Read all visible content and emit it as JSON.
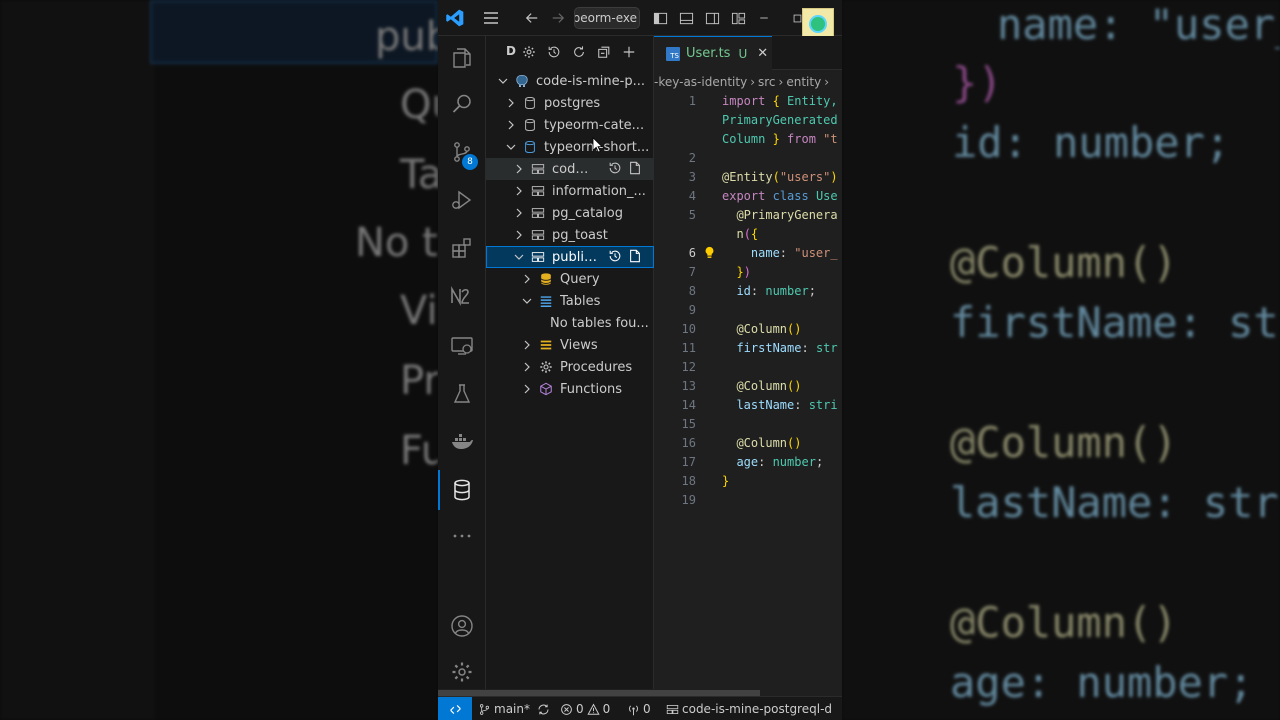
{
  "window": {
    "command_center_text": "ypeorm-exe"
  },
  "background_left": {
    "labels": [
      "pub",
      "Qu",
      "Ta",
      "No t",
      "Vi",
      "Pr",
      "Fu"
    ]
  },
  "background_right": {
    "lines": [
      "name:  \"user_",
      "})",
      "id:  number;",
      "@Column()",
      "firstName:  str",
      "@Column()",
      "lastName:  stri",
      "@Column()",
      "age:  number;"
    ]
  },
  "activity_bar": {
    "scm_badge": "8",
    "items": [
      "explorer-icon",
      "search-icon",
      "source-control-icon",
      "run-debug-icon",
      "extensions-icon",
      "n8n-icon",
      "remote-explorer-icon",
      "testing-icon",
      "docker-icon",
      "database-icon",
      "more-icon",
      "accounts-icon",
      "manage-icon"
    ]
  },
  "sidebar": {
    "title_fragment": "D",
    "tree": {
      "connection": "code-is-mine-p...",
      "databases": [
        "postgres",
        "typeorm-cate...",
        "typeorm-short..."
      ],
      "schemas": [
        "codei...",
        "information_...",
        "pg_catalog",
        "pg_toast",
        "public..."
      ],
      "public_children": {
        "query": "Query",
        "tables": "Tables",
        "no_tables": "No tables fou...",
        "views": "Views",
        "procedures": "Procedures",
        "functions": "Functions"
      }
    }
  },
  "editor": {
    "tab": {
      "file_name": "User.ts",
      "ts_badge": "TS",
      "status": "U",
      "close": "✕"
    },
    "breadcrumbs": [
      "-key-as-identity",
      "›",
      "src",
      "›",
      "entity",
      "›"
    ],
    "line_numbers": [
      "1",
      "",
      "",
      "2",
      "3",
      "4",
      "5",
      "",
      "6",
      "7",
      "8",
      "9",
      "10",
      "11",
      "12",
      "13",
      "14",
      "15",
      "16",
      "17",
      "18",
      "19"
    ],
    "code": {
      "l1a": "import",
      "l1b": " { ",
      "l1c": "Entity,",
      "l1d": "PrimaryGenerated",
      "l1e": "Column",
      "l1f": " } ",
      "l1g": "from",
      "l1h": " \"t",
      "l3a": "@Entity",
      "l3b": "(",
      "l3c": "\"users\"",
      "l3d": ")",
      "l4a": "export",
      "l4b": " ",
      "l4c": "class",
      "l4d": " ",
      "l4e": "Use",
      "l5a": "  @PrimaryGenera",
      "l5b": "  n",
      "l5c": "(",
      "l5d": "{",
      "l6a": "    name",
      "l6b": ": ",
      "l6c": "\"user_",
      "l7a": "  ",
      "l7b": "}",
      "l7c": ")",
      "l8a": "  id",
      "l8b": ": ",
      "l8c": "number",
      "l8d": ";",
      "l10a": "  @Column",
      "l10b": "()",
      "l11a": "  firstName",
      "l11b": ": ",
      "l11c": "str",
      "l13a": "  @Column",
      "l13b": "()",
      "l14a": "  lastName",
      "l14b": ": ",
      "l14c": "stri",
      "l16a": "  @Column",
      "l16b": "()",
      "l17a": "  age",
      "l17b": ": ",
      "l17c": "number",
      "l17d": ";",
      "l18a": "}"
    }
  },
  "statusbar": {
    "branch": "main*",
    "errors": "0",
    "warnings": "0",
    "ports": "0",
    "connection": "code-is-mine-postgreql-d"
  },
  "colors": {
    "accent": "#0078d4",
    "untracked_file": "#73c991",
    "selection": "#04395e"
  }
}
